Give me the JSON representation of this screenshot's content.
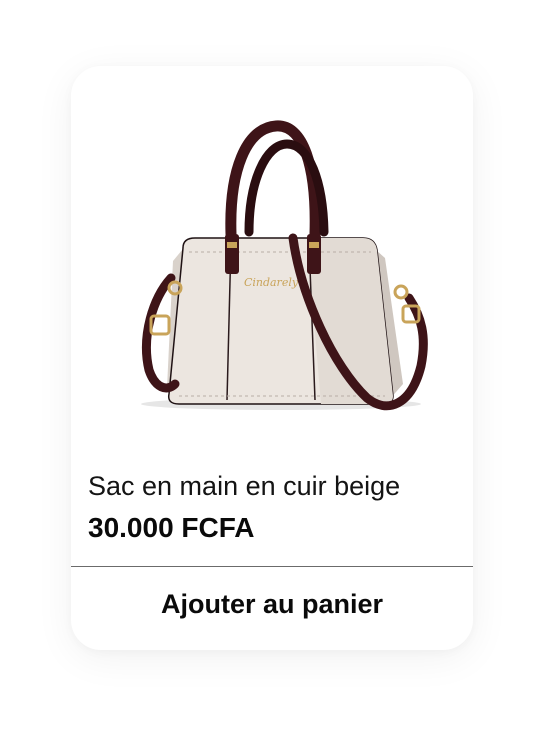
{
  "product": {
    "image_alt": "sac à main beige",
    "brand_mark": "Cindarely",
    "name": "Sac en main en cuir beige",
    "price": "30.000 FCFA",
    "add_to_cart_label": "Ajouter au panier"
  },
  "colors": {
    "bag_body": "#ece6e0",
    "bag_trim": "#3e1418",
    "hardware": "#c9a45a"
  }
}
